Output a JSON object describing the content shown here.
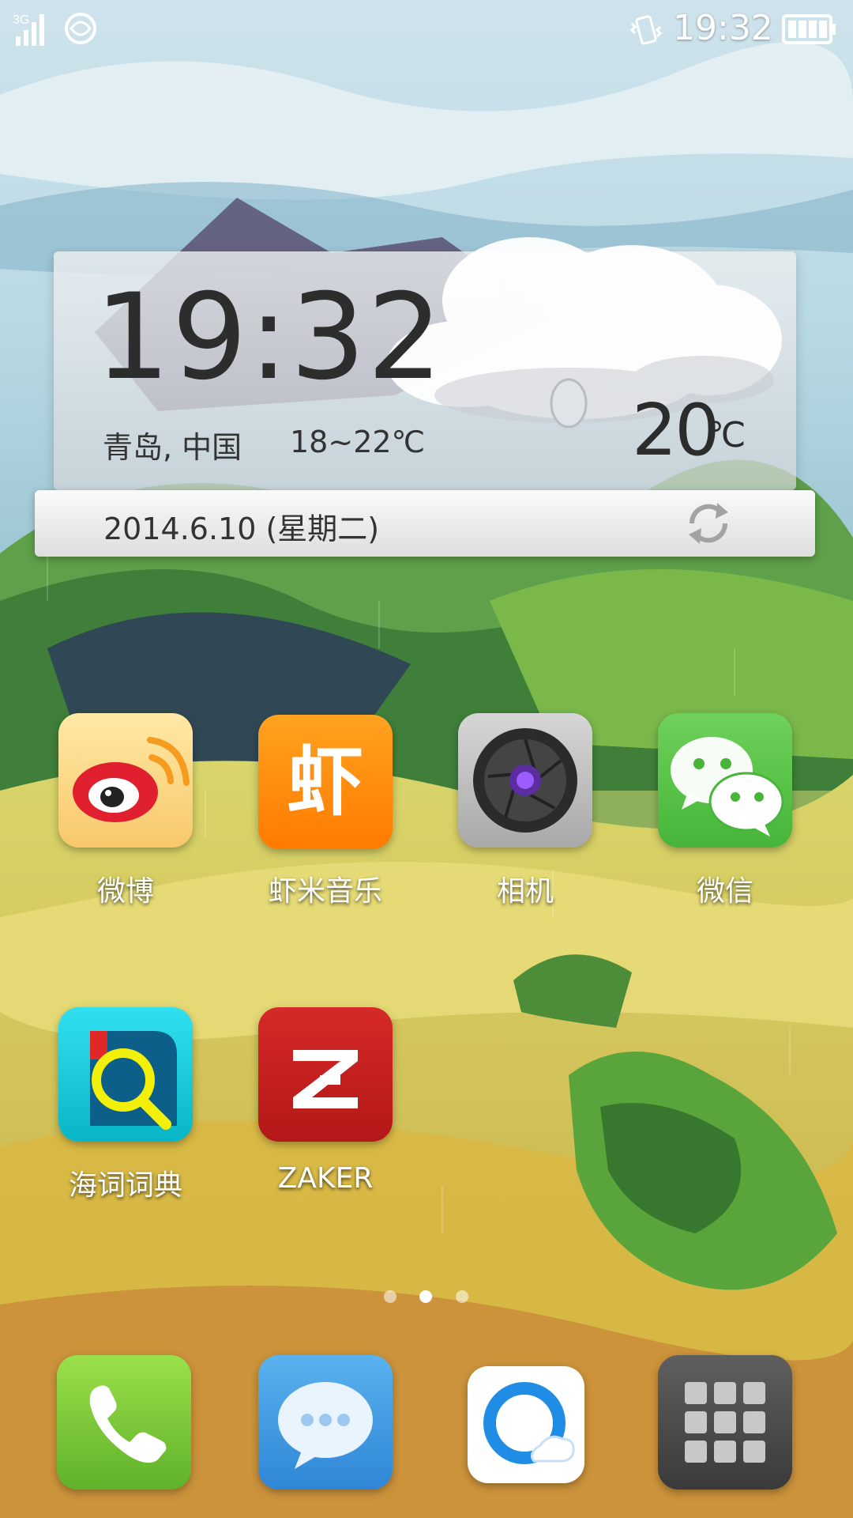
{
  "status_bar": {
    "network": "3G",
    "time": "19:32"
  },
  "weather_widget": {
    "time": "19:32",
    "city": "青岛, 中国",
    "temp_range": "18~22℃",
    "temperature": "20",
    "temp_unit": "℃",
    "date": "2014.6.10 (星期二)"
  },
  "apps": [
    {
      "label": "微博",
      "icon": "weibo-icon"
    },
    {
      "label": "虾米音乐",
      "icon": "xiami-music-icon"
    },
    {
      "label": "相机",
      "icon": "camera-icon"
    },
    {
      "label": "微信",
      "icon": "wechat-icon"
    },
    {
      "label": "海词词典",
      "icon": "dict-icon"
    },
    {
      "label": "ZAKER",
      "icon": "zaker-icon"
    }
  ],
  "icon_glyphs": {
    "xiami": "虾"
  },
  "page_indicator": {
    "pages": 3,
    "current": 2
  },
  "dock": [
    {
      "icon": "phone-icon"
    },
    {
      "icon": "messages-icon"
    },
    {
      "icon": "qq-browser-icon"
    },
    {
      "icon": "app-drawer-icon"
    }
  ]
}
